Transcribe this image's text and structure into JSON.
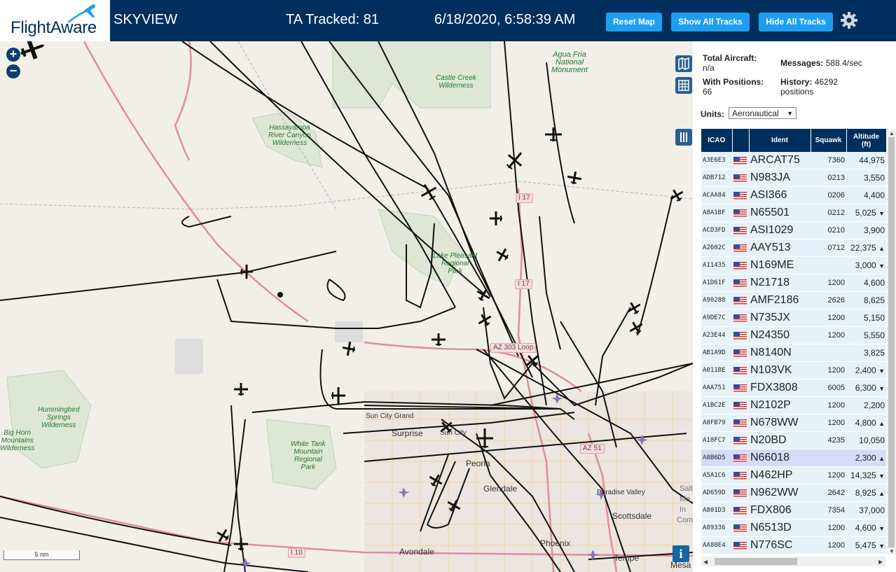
{
  "header": {
    "logo_text": "FlightAware",
    "app_name": "SKYVIEW",
    "ta_tracked": "TA Tracked: 81",
    "datetime": "6/18/2020, 6:58:39 AM",
    "buttons": {
      "reset_map": "Reset Map",
      "show_all_tracks": "Show All Tracks",
      "hide_all_tracks": "Hide All Tracks"
    },
    "accent_color": "#1e9ef0",
    "bar_color": "#002f5d"
  },
  "map": {
    "zoom_in": "+",
    "zoom_out": "−",
    "scale_label": "5 nm",
    "info_label": "i",
    "labels": {
      "agua_fria": "Agua Fria\nNational\nMonument",
      "castle_creek": "Castle Creek\nWilderness",
      "hassayampa": "Hassayampa\nRiver Canyon\nWilderness",
      "lake_pleasant": "Lake Pleasant\nRegional\nPark",
      "hummingbird": "Hummingbird\nSprings\nWilderness",
      "big_horn": "Big Horn\nMountains\nWilderness",
      "white_tank": "White Tank\nMountain\nRegional\nPark",
      "sun_city_grand": "Sun City Grand",
      "surprise": "Surprise",
      "sun_city": "Sun City",
      "peoria": "Peoria",
      "glendale": "Glendale",
      "paradise_valley": "Paradise Valley",
      "scottsdale": "Scottsdale",
      "avondale": "Avondale",
      "phoenix": "Phoenix",
      "tempe": "Tempe",
      "mesa": "Mesa",
      "salt": "Salt",
      "ma": "Ma",
      "in": "In",
      "com": "Com"
    },
    "roads": {
      "i17a": "I 17",
      "i17b": "I 17",
      "az303": "AZ 303 Loop",
      "az51": "AZ 51",
      "i10": "I 10"
    }
  },
  "sidebar": {
    "total_aircraft_label": "Total Aircraft:",
    "total_aircraft_value": "n/a",
    "messages_label": "Messages:",
    "messages_value": "588.4/sec",
    "with_positions_label": "With Positions:",
    "with_positions_value": "66",
    "history_label": "History:",
    "history_value": "46292",
    "history_unit": "positions",
    "units_label": "Units:",
    "units_value": "Aeronautical",
    "table": {
      "headers": {
        "icao": "ICAO",
        "ident": "Ident",
        "squawk": "Squawk",
        "altitude": "Altitude",
        "altitude_unit": "(ft)"
      },
      "rows": [
        {
          "icao": "A3E6E3",
          "ident": "ARCAT75",
          "squawk": "7360",
          "alt": "44,975",
          "trend": ""
        },
        {
          "icao": "ADB712",
          "ident": "N983JA",
          "squawk": "0213",
          "alt": "3,550",
          "trend": ""
        },
        {
          "icao": "ACAA84",
          "ident": "ASI366",
          "squawk": "0206",
          "alt": "4,400",
          "trend": ""
        },
        {
          "icao": "A8A1BF",
          "ident": "N65501",
          "squawk": "0212",
          "alt": "5,025",
          "trend": "▼"
        },
        {
          "icao": "ACD3FD",
          "ident": "ASI1029",
          "squawk": "0210",
          "alt": "3,900",
          "trend": ""
        },
        {
          "icao": "A2602C",
          "ident": "AAY513",
          "squawk": "0712",
          "alt": "22,375",
          "trend": "▲"
        },
        {
          "icao": "A11435",
          "ident": "N169ME",
          "squawk": "",
          "alt": "3,000",
          "trend": "▼"
        },
        {
          "icao": "A1D61F",
          "ident": "N21718",
          "squawk": "1200",
          "alt": "4,600",
          "trend": ""
        },
        {
          "icao": "A90288",
          "ident": "AMF2186",
          "squawk": "2626",
          "alt": "8,625",
          "trend": ""
        },
        {
          "icao": "A9DE7C",
          "ident": "N735JX",
          "squawk": "1200",
          "alt": "5,150",
          "trend": ""
        },
        {
          "icao": "A23E44",
          "ident": "N24350",
          "squawk": "1200",
          "alt": "5,550",
          "trend": ""
        },
        {
          "icao": "AB1A9D",
          "ident": "N8140N",
          "squawk": "",
          "alt": "3,825",
          "trend": ""
        },
        {
          "icao": "A011BE",
          "ident": "N103VK",
          "squawk": "1200",
          "alt": "2,400",
          "trend": "▼"
        },
        {
          "icao": "AAA751",
          "ident": "FDX3808",
          "squawk": "6005",
          "alt": "6,300",
          "trend": "▼"
        },
        {
          "icao": "A1BC2E",
          "ident": "N2102P",
          "squawk": "1200",
          "alt": "2,200",
          "trend": ""
        },
        {
          "icao": "A8FB79",
          "ident": "N678WW",
          "squawk": "1200",
          "alt": "4,800",
          "trend": "▲"
        },
        {
          "icao": "A18FC7",
          "ident": "N20BD",
          "squawk": "4235",
          "alt": "10,050",
          "trend": ""
        },
        {
          "icao": "A8B6D5",
          "ident": "N66018",
          "squawk": "",
          "alt": "2,300",
          "trend": "▲"
        },
        {
          "icao": "A5A1C6",
          "ident": "N462HP",
          "squawk": "1200",
          "alt": "14,325",
          "trend": "▼"
        },
        {
          "icao": "AD659D",
          "ident": "N962WW",
          "squawk": "2642",
          "alt": "8,925",
          "trend": "▲"
        },
        {
          "icao": "A801D3",
          "ident": "FDX806",
          "squawk": "7354",
          "alt": "37,000",
          "trend": ""
        },
        {
          "icao": "A89336",
          "ident": "N6513D",
          "squawk": "1200",
          "alt": "4,600",
          "trend": "▼"
        },
        {
          "icao": "AA80E4",
          "ident": "N776SC",
          "squawk": "1200",
          "alt": "5,475",
          "trend": "▼"
        }
      ],
      "selected_index": 17
    }
  }
}
